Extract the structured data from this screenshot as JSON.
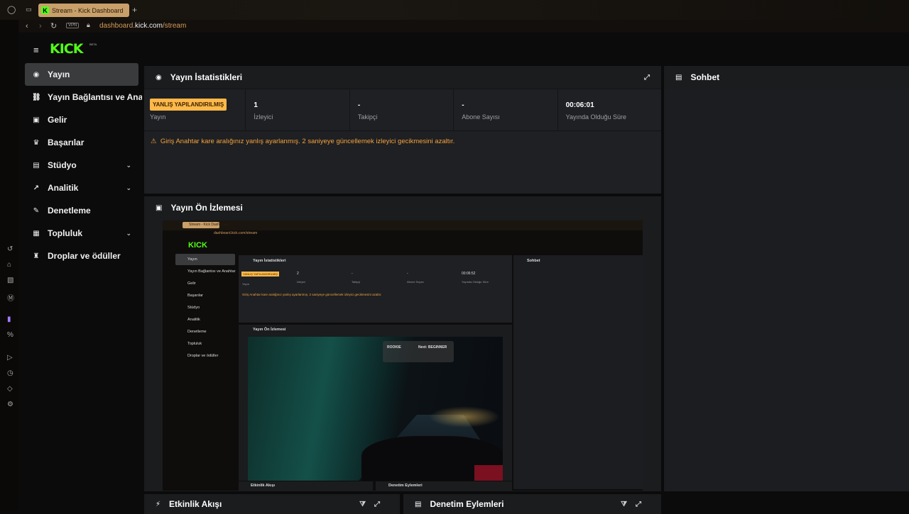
{
  "browser": {
    "tab_title": "Stream - Kick Dashboard",
    "tab_favicon": "K",
    "new_tab": "+",
    "vpn_label": "VPN",
    "url_prefix": "dashboard.",
    "url_domain": "kick.com",
    "url_path": "/stream"
  },
  "brand": {
    "logo": "KICK",
    "beta": "BETA",
    "accent": "#53fc18"
  },
  "sidebar": {
    "items": [
      {
        "label": "Yayın",
        "icon": "broadcast-icon",
        "glyph": "◉",
        "active": true
      },
      {
        "label": "Yayın Bağlantısı ve Anahtar",
        "icon": "link-icon",
        "glyph": "🔗"
      },
      {
        "label": "Gelir",
        "icon": "revenue-icon",
        "glyph": "▣"
      },
      {
        "label": "Başarılar",
        "icon": "trophy-icon",
        "glyph": "♛"
      },
      {
        "label": "Stüdyo",
        "icon": "studio-icon",
        "glyph": "▤",
        "expandable": true
      },
      {
        "label": "Analitik",
        "icon": "chart-icon",
        "glyph": "↗",
        "expandable": true
      },
      {
        "label": "Denetleme",
        "icon": "wrench-icon",
        "glyph": "✎"
      },
      {
        "label": "Topluluk",
        "icon": "community-icon",
        "glyph": "▦",
        "expandable": true
      },
      {
        "label": "Droplar ve ödüller",
        "icon": "gift-icon",
        "glyph": "♜"
      }
    ]
  },
  "stats_panel": {
    "title": "Yayın İstatistikleri",
    "status_badge": "YANLIŞ YAPILANDIRILMIŞ",
    "status_label": "Yayın",
    "viewers_value": "1",
    "viewers_label": "İzleyici",
    "followers_value": "-",
    "followers_label": "Takipçi",
    "subs_value": "-",
    "subs_label": "Abone Sayısı",
    "uptime_value": "00:06:01",
    "uptime_label": "Yayında Olduğu Süre",
    "warning": "Giriş Anahtar kare aralığınız yanlış ayarlanmış. 2 saniyeye güncellemek izleyici gecikmesini azaltır."
  },
  "chat_panel": {
    "title": "Sohbet"
  },
  "preview_panel": {
    "title": "Yayın Ön İzlemesi"
  },
  "activity_panel": {
    "title": "Etkinlik Akışı"
  },
  "moderation_panel": {
    "title": "Denetim Eylemleri"
  },
  "nested_preview": {
    "tab_title": "Stream - Kick Dashboard",
    "url": "dashboard.kick.com/stream",
    "logo": "KICK",
    "nav": [
      "Yayın",
      "Yayın Bağlantısı ve Anahtar",
      "Gelir",
      "Başarılar",
      "Stüdyo",
      "Analitik",
      "Denetleme",
      "Topluluk",
      "Droplar ve ödüller"
    ],
    "stats_title": "Yayın İstatistikleri",
    "status_badge": "YANLIŞ YAPILANDIRILMIŞ",
    "status_label": "Yayın",
    "viewers_value": "2",
    "viewers_label": "İzleyici",
    "followers_value": "-",
    "followers_label": "Takipçi",
    "subs_value": "-",
    "subs_label": "Abone Sayısı",
    "uptime_value": "00:06:52",
    "uptime_label": "Yayında Olduğu Süre",
    "warning": "Giriş Anahtar kare aralığınız yanlış ayarlanmış. 2 saniyeye güncellemek izleyici gecikmesini azaltır.",
    "chat_title": "Sohbet",
    "preview_title": "Yayın Ön İzlemesi",
    "activity_title": "Etkinlik Akışı",
    "moderation_title": "Denetim Eylemleri",
    "game_hud_rank": "ROOKIE",
    "game_hud_next": "Next: BEGINNER"
  }
}
